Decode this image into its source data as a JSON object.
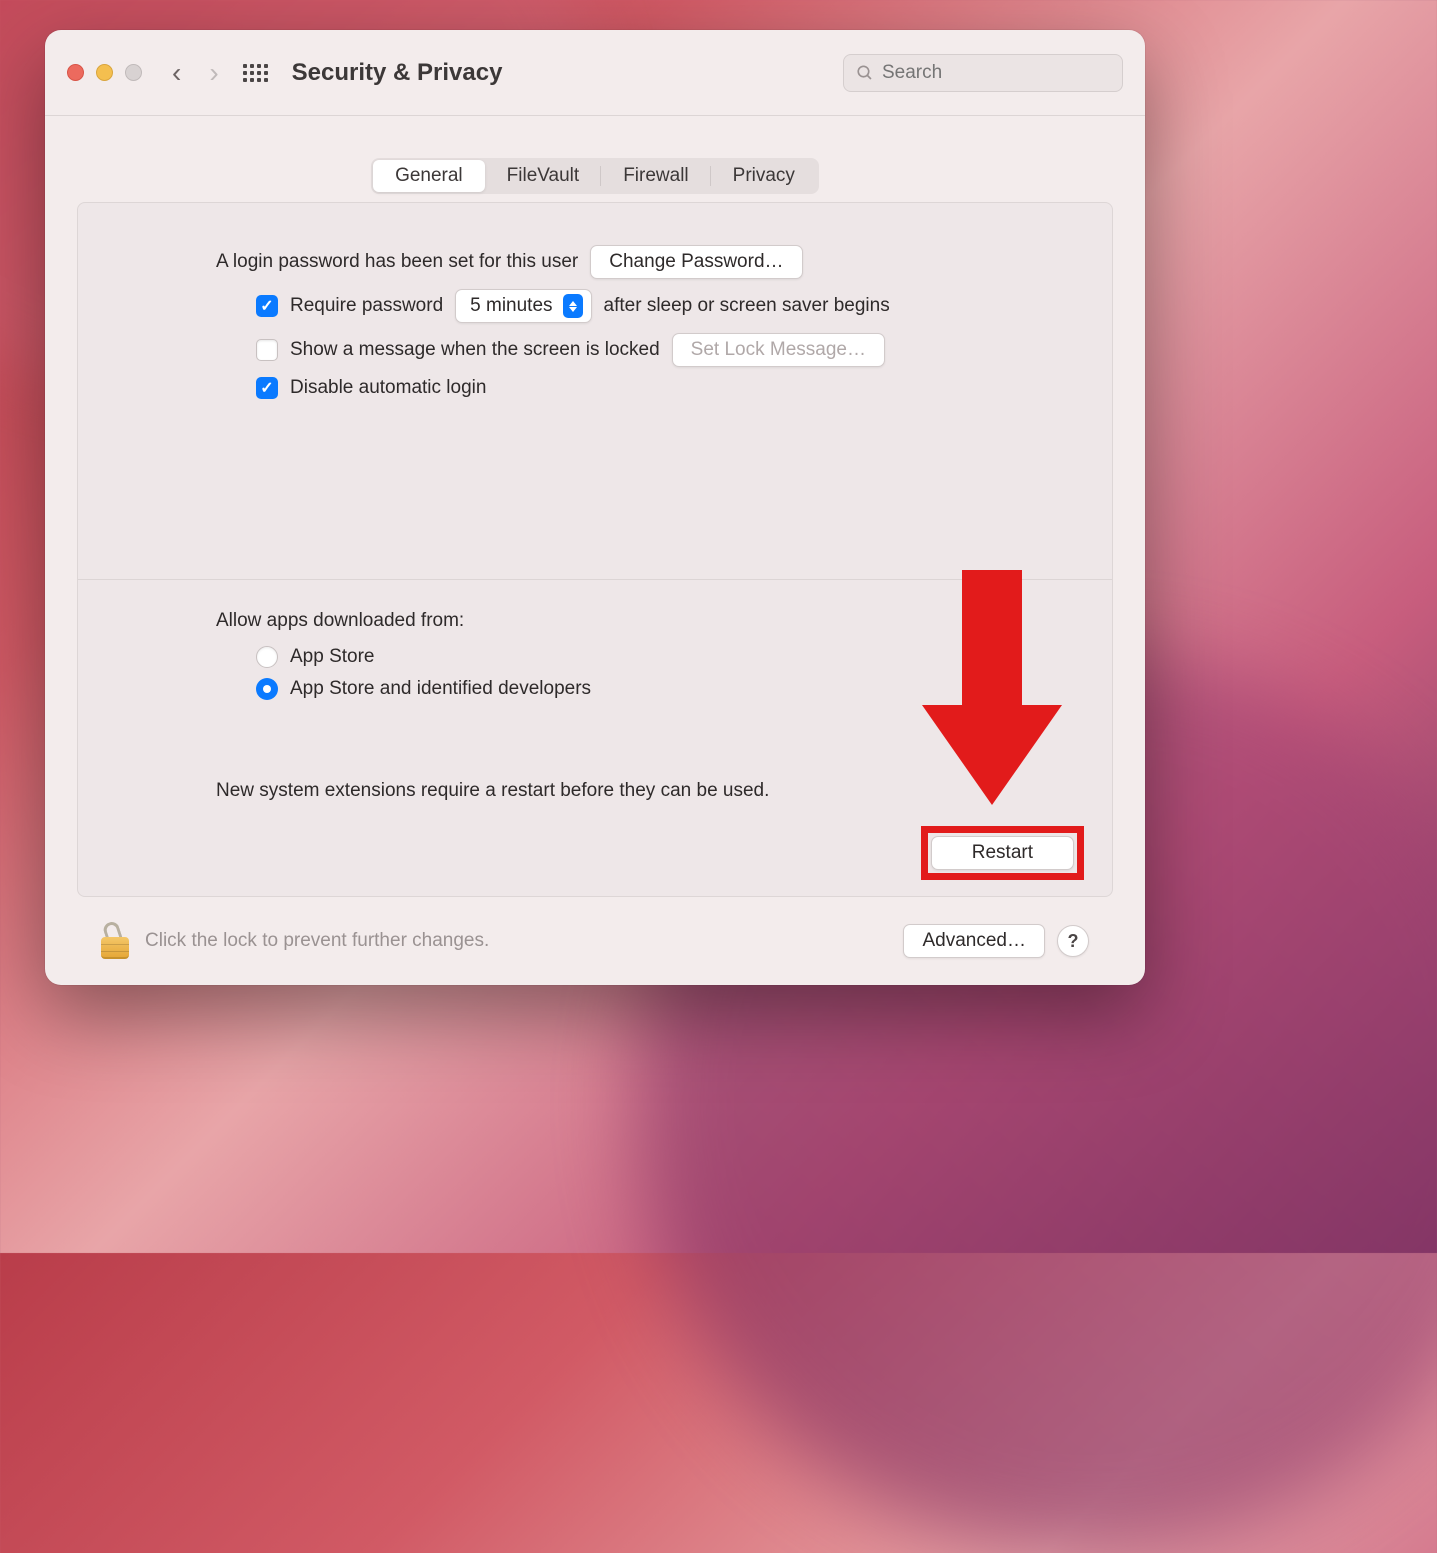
{
  "header": {
    "title": "Security & Privacy",
    "search_placeholder": "Search"
  },
  "tabs": [
    {
      "label": "General",
      "active": true
    },
    {
      "label": "FileVault",
      "active": false
    },
    {
      "label": "Firewall",
      "active": false
    },
    {
      "label": "Privacy",
      "active": false
    }
  ],
  "login": {
    "password_set_text": "A login password has been set for this user",
    "change_password_btn": "Change Password…",
    "require_password_label": "Require password",
    "require_password_checked": true,
    "delay_value": "5 minutes",
    "after_text": "after sleep or screen saver begins",
    "show_message_label": "Show a message when the screen is locked",
    "show_message_checked": false,
    "set_lock_message_btn": "Set Lock Message…",
    "disable_auto_login_label": "Disable automatic login",
    "disable_auto_login_checked": true
  },
  "downloads": {
    "section_label": "Allow apps downloaded from:",
    "options": [
      {
        "label": "App Store",
        "selected": false
      },
      {
        "label": "App Store and identified developers",
        "selected": true
      }
    ]
  },
  "extensions": {
    "message": "New system extensions require a restart before they can be used.",
    "restart_btn": "Restart"
  },
  "footer": {
    "lock_text": "Click the lock to prevent further changes.",
    "advanced_btn": "Advanced…",
    "help_label": "?"
  },
  "annotation": {
    "arrow_color": "#e21b1b"
  }
}
